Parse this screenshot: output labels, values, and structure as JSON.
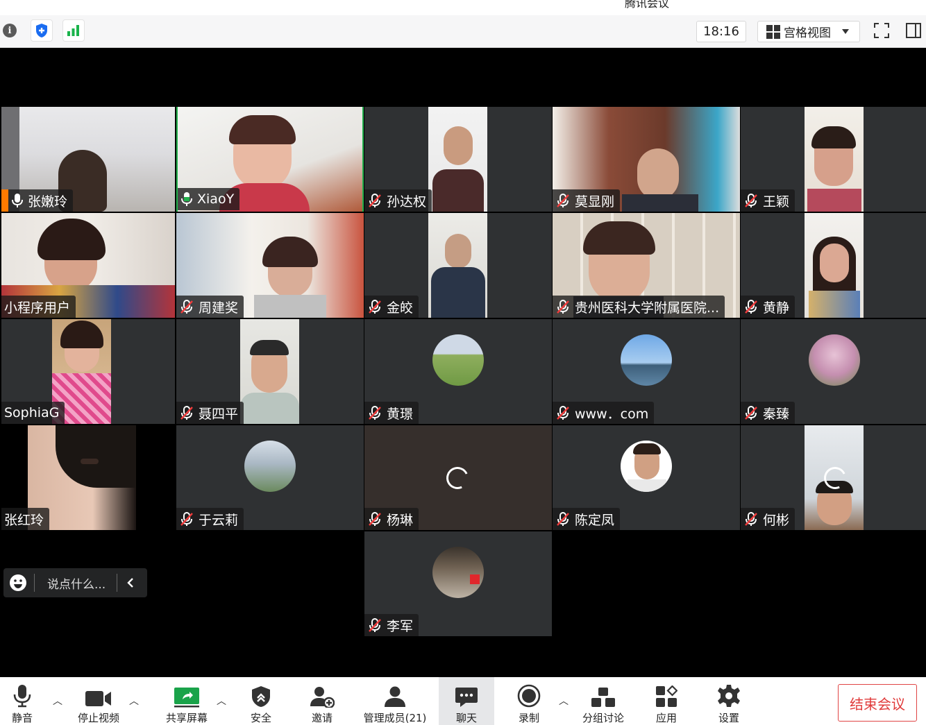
{
  "window": {
    "title": "腾讯会议"
  },
  "topbar": {
    "time": "18:16",
    "view_mode": "宫格视图"
  },
  "participants": [
    {
      "name": "张嫩玲",
      "mic": "on"
    },
    {
      "name": "XiaoY",
      "mic": "on"
    },
    {
      "name": "孙达权",
      "mic": "off"
    },
    {
      "name": "莫显刚",
      "mic": "off"
    },
    {
      "name": "王颖",
      "mic": "off"
    },
    {
      "name": "小程序用户",
      "mic": "off"
    },
    {
      "name": "周建奖",
      "mic": "off"
    },
    {
      "name": "金皎",
      "mic": "off"
    },
    {
      "name": "贵州医科大学附属医院...",
      "mic": "off"
    },
    {
      "name": "黄静",
      "mic": "off"
    },
    {
      "name": "SophiaG",
      "mic": "off"
    },
    {
      "name": "聂四平",
      "mic": "off"
    },
    {
      "name": "黄璟",
      "mic": "off"
    },
    {
      "name": "www．com",
      "mic": "off"
    },
    {
      "name": "秦臻",
      "mic": "off"
    },
    {
      "name": "张红玲",
      "mic": "off"
    },
    {
      "name": "于云莉",
      "mic": "off"
    },
    {
      "name": "杨琳",
      "mic": "off"
    },
    {
      "name": "陈定凤",
      "mic": "off"
    },
    {
      "name": "何彬",
      "mic": "off"
    },
    {
      "name": "李军",
      "mic": "off"
    }
  ],
  "chat": {
    "placeholder": "说点什么..."
  },
  "toolbar": {
    "mute": "静音",
    "stop_video": "停止视频",
    "share_screen": "共享屏幕",
    "security": "安全",
    "invite": "邀请",
    "manage_members": "管理成员(21)",
    "chat": "聊天",
    "record": "录制",
    "breakout": "分组讨论",
    "apps": "应用",
    "settings": "设置",
    "end_meeting": "结束会议"
  },
  "colors": {
    "active_speaker": "#22b14c",
    "end_button": "#e03a3a",
    "tile_bg": "#2f3133"
  }
}
